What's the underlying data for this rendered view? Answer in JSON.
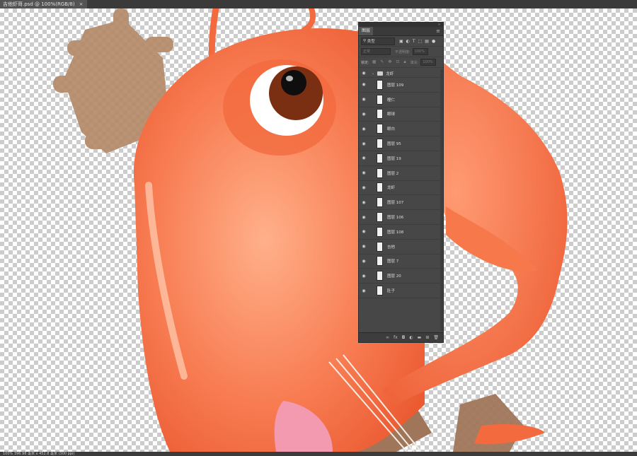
{
  "document": {
    "tab_title": "吉他虾哥.psd @ 100%(RGB/8)",
    "close_glyph": "×"
  },
  "status_bar": {
    "text": "100%   396.98 毫米 x 452.8 毫米 (300 ppi)"
  },
  "layers_panel": {
    "tab_label": "图层",
    "menu_glyph": "≡",
    "filter": {
      "kind_label": "类型",
      "icons": [
        "image-filter-icon",
        "adjustment-filter-icon",
        "type-filter-icon",
        "shape-filter-icon",
        "smart-object-filter-icon"
      ]
    },
    "blend_mode": "正常",
    "opacity_label": "不透明度:",
    "opacity_value": "100%",
    "lock_label": "锁定:",
    "fill_label": "填充:",
    "fill_value": "100%",
    "group_name": "龙虾",
    "layers": [
      {
        "name": "图层 109"
      },
      {
        "name": "瞳仁"
      },
      {
        "name": "眼球"
      },
      {
        "name": "眼白"
      },
      {
        "name": "图层 95"
      },
      {
        "name": "图层 19"
      },
      {
        "name": "图层 2"
      },
      {
        "name": "龙虾"
      },
      {
        "name": "图层 107"
      },
      {
        "name": "图层 106"
      },
      {
        "name": "图层 108"
      },
      {
        "name": "吉他"
      },
      {
        "name": "图层 7"
      },
      {
        "name": "图层 20"
      },
      {
        "name": "肚子"
      }
    ],
    "footer_icons": [
      "link-icon",
      "fx-icon",
      "mask-icon",
      "adjustment-icon",
      "folder-icon",
      "new-layer-icon",
      "trash-icon"
    ]
  },
  "colors": {
    "lobster_orange": "#f2643a",
    "guitar_brown": "#b58a6a",
    "ui_dark": "#474747"
  }
}
